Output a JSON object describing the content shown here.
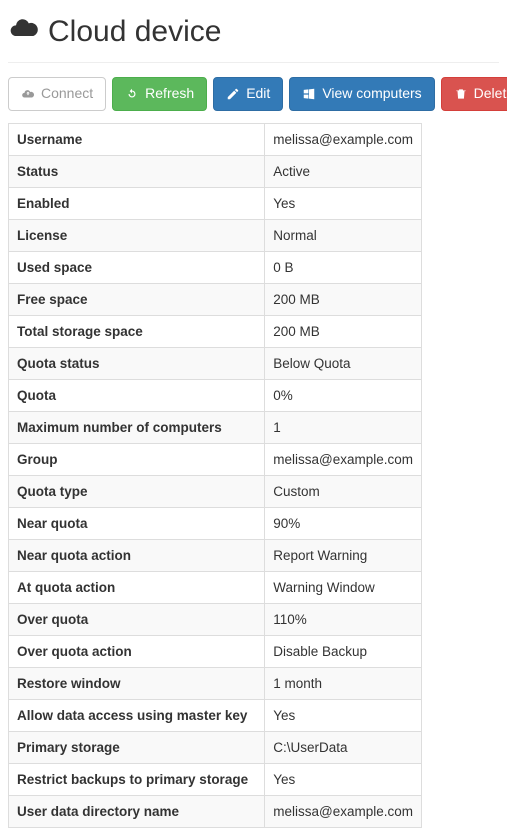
{
  "header": {
    "title": "Cloud device"
  },
  "toolbar": {
    "connect_label": "Connect",
    "refresh_label": "Refresh",
    "edit_label": "Edit",
    "view_computers_label": "View computers",
    "delete_label": "Delete"
  },
  "details": {
    "rows": [
      {
        "label": "Username",
        "value": "melissa@example.com"
      },
      {
        "label": "Status",
        "value": "Active"
      },
      {
        "label": "Enabled",
        "value": "Yes"
      },
      {
        "label": "License",
        "value": "Normal"
      },
      {
        "label": "Used space",
        "value": "0 B"
      },
      {
        "label": "Free space",
        "value": "200 MB"
      },
      {
        "label": "Total storage space",
        "value": "200 MB"
      },
      {
        "label": "Quota status",
        "value": "Below Quota"
      },
      {
        "label": "Quota",
        "value": "0%"
      },
      {
        "label": "Maximum number of computers",
        "value": "1"
      },
      {
        "label": "Group",
        "value": "melissa@example.com"
      },
      {
        "label": "Quota type",
        "value": "Custom"
      },
      {
        "label": "Near quota",
        "value": "90%"
      },
      {
        "label": "Near quota action",
        "value": "Report Warning"
      },
      {
        "label": "At quota action",
        "value": "Warning Window"
      },
      {
        "label": "Over quota",
        "value": "110%"
      },
      {
        "label": "Over quota action",
        "value": "Disable Backup"
      },
      {
        "label": "Restore window",
        "value": "1 month"
      },
      {
        "label": "Allow data access using master key",
        "value": "Yes"
      },
      {
        "label": "Primary storage",
        "value": "C:\\UserData"
      },
      {
        "label": "Restrict backups to primary storage",
        "value": "Yes"
      },
      {
        "label": "User data directory name",
        "value": "melissa@example.com"
      }
    ]
  }
}
